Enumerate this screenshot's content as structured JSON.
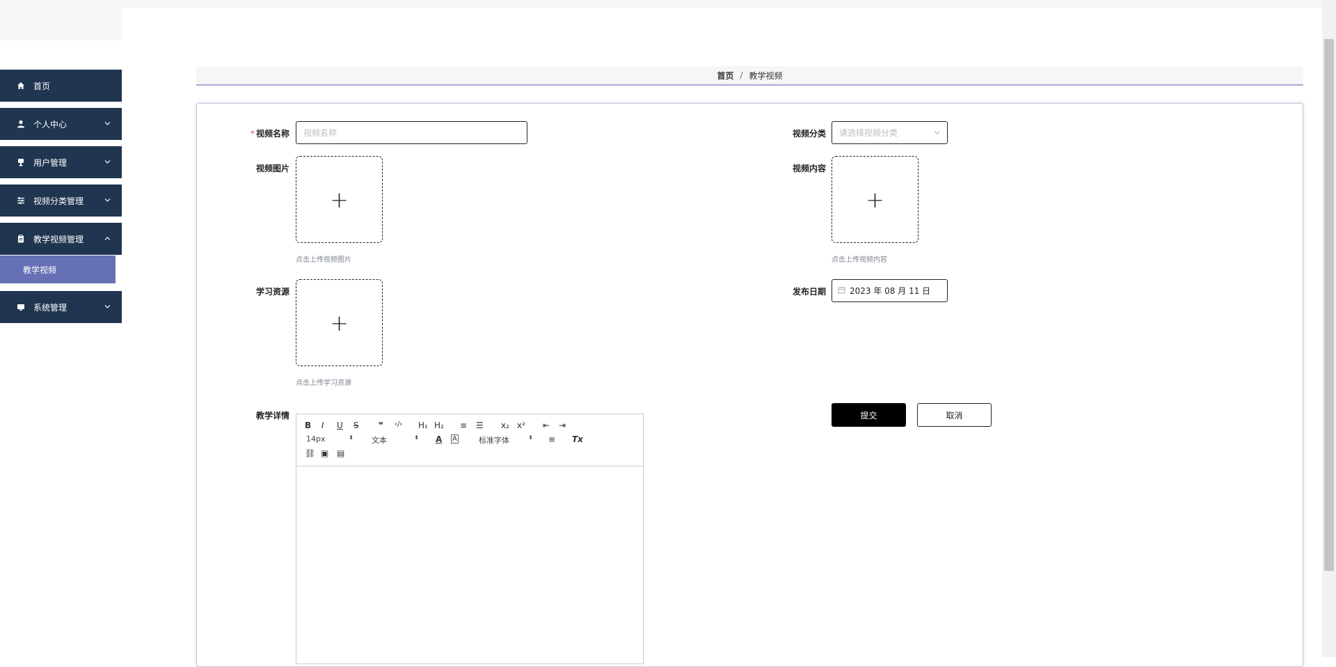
{
  "sidebar": {
    "items": [
      {
        "label": "首页",
        "icon": "home-icon"
      },
      {
        "label": "个人中心",
        "icon": "user-icon"
      },
      {
        "label": "用户管理",
        "icon": "users-icon"
      },
      {
        "label": "视频分类管理",
        "icon": "sliders-icon"
      },
      {
        "label": "教学视频管理",
        "icon": "clipboard-icon"
      },
      {
        "label": "系统管理",
        "icon": "monitor-icon"
      }
    ],
    "submenu": {
      "label": "教学视频"
    }
  },
  "breadcrumb": {
    "home": "首页",
    "separator": "/",
    "current": "教学视频"
  },
  "form": {
    "name_label": "视频名称",
    "name_required_mark": "*",
    "name_placeholder": "视频名称",
    "category_label": "视频分类",
    "category_placeholder": "请选择视频分类",
    "image_label": "视频图片",
    "image_hint": "点击上传视频图片",
    "content_label": "视频内容",
    "content_hint": "点击上传视频内容",
    "resource_label": "学习资源",
    "resource_hint": "点击上传学习资源",
    "date_label": "发布日期",
    "date_value": "2023 年 08 月 11 日",
    "detail_label": "教学详情",
    "submit_label": "提交",
    "cancel_label": "取消",
    "upload_plus": "+"
  },
  "editor": {
    "size_value": "14px",
    "header_value": "文本",
    "font_value": "标准字体",
    "buttons": {
      "bold": "B",
      "italic": "I",
      "underline": "U",
      "strike": "S",
      "blockquote": "❞",
      "code": "‹/›",
      "h1": "H₁",
      "h2": "H₂",
      "ordered": "≡",
      "bullet": "☰",
      "sub": "x₂",
      "sup": "x²",
      "outdent": "⇤",
      "indent": "⇥",
      "color": "A",
      "background": "A",
      "align": "≡",
      "clean": "Tx",
      "link": "⛓",
      "image": "▣",
      "video": "▤"
    }
  }
}
